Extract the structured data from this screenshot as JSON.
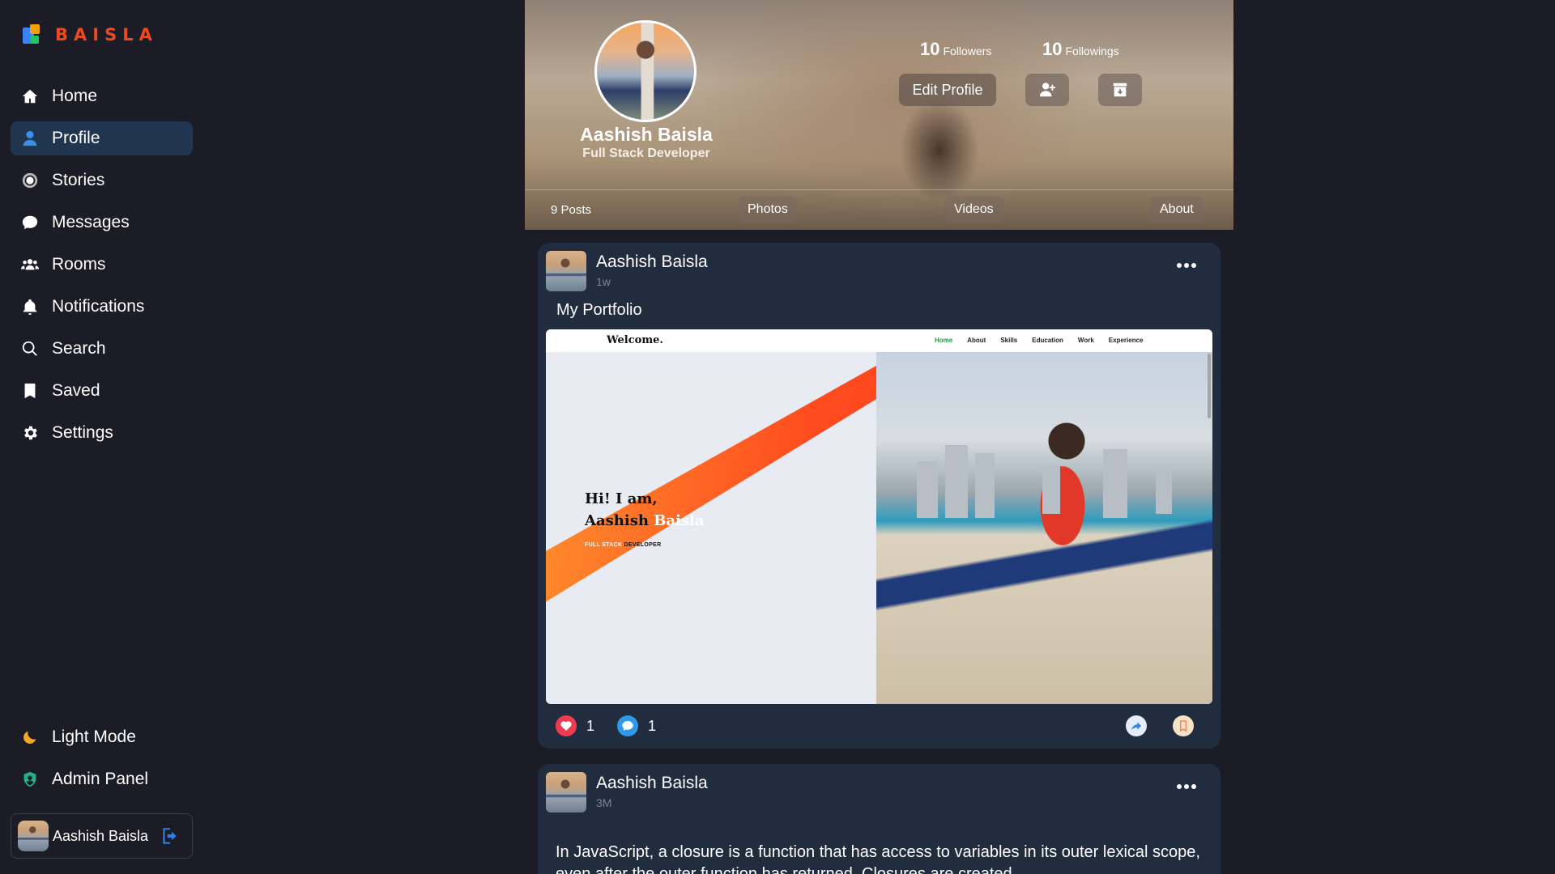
{
  "brand": {
    "name": "BAISLA"
  },
  "nav": {
    "items": [
      {
        "label": "Home",
        "icon": "home-icon"
      },
      {
        "label": "Profile",
        "icon": "user-icon"
      },
      {
        "label": "Stories",
        "icon": "stories-icon"
      },
      {
        "label": "Messages",
        "icon": "messages-icon"
      },
      {
        "label": "Rooms",
        "icon": "rooms-icon"
      },
      {
        "label": "Notifications",
        "icon": "bell-icon"
      },
      {
        "label": "Search",
        "icon": "search-icon"
      },
      {
        "label": "Saved",
        "icon": "bookmark-icon"
      },
      {
        "label": "Settings",
        "icon": "gear-icon"
      }
    ],
    "active": "Profile",
    "bottom": [
      {
        "label": "Light Mode",
        "icon": "moon-icon"
      },
      {
        "label": "Admin Panel",
        "icon": "admin-icon"
      }
    ]
  },
  "user": {
    "name": "Aashish Baisla"
  },
  "profile": {
    "name": "Aashish Baisla",
    "role": "Full Stack Developer",
    "followers_count": "10",
    "followers_label": "Followers",
    "followings_count": "10",
    "followings_label": "Followings",
    "edit_label": "Edit Profile",
    "posts_count": "9 Posts",
    "tabs": [
      "Photos",
      "Videos",
      "About"
    ]
  },
  "posts": [
    {
      "author": "Aashish Baisla",
      "time": "1w",
      "title": "My Portfolio",
      "image": {
        "welcome": "Welcome.",
        "nav_links": [
          "Home",
          "About",
          "Skills",
          "Education",
          "Work",
          "Experience"
        ],
        "greeting_line1": "Hi! I am,",
        "greeting_name_1": "Aashish ",
        "greeting_name_2": "Baisla",
        "role_1": "FULL STACK ",
        "role_2": "DEVELOPER"
      },
      "likes": "1",
      "comments": "1"
    },
    {
      "author": "Aashish Baisla",
      "time": "3M",
      "text": "In JavaScript, a closure is a function that has access to variables in its outer lexical scope, even after the outer function has returned. Closures are created"
    }
  ],
  "colors": {
    "background": "#1c1c27",
    "card": "#212d3f",
    "active_nav": "#1f3550",
    "brand": "#ef4a1f",
    "like": "#ef3b4f",
    "comment": "#2f9be8"
  }
}
